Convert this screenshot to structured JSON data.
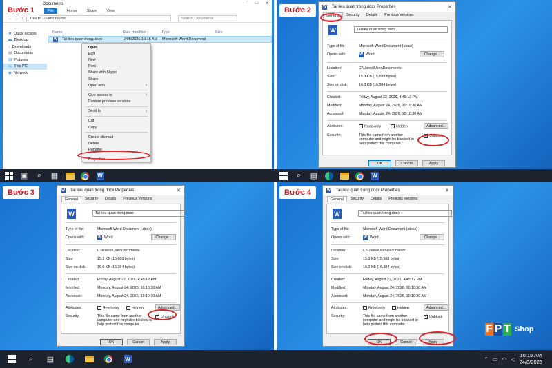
{
  "steps": [
    "Bước 1",
    "Bước 2",
    "Bước 3",
    "Bước 4"
  ],
  "explorer": {
    "title": "Documents",
    "menu": [
      "File",
      "Home",
      "Share",
      "View"
    ],
    "breadcrumb": "This PC  ›  Documents",
    "search_placeholder": "Search Documents",
    "sidebar": [
      "Quick access",
      "Desktop",
      "Downloads",
      "Documents",
      "Pictures",
      "This PC",
      "Network"
    ],
    "columns": [
      "Name",
      "Date modified",
      "Type",
      "Size"
    ],
    "file": {
      "name": "Tai lieu quan trong.docx",
      "date": "24/8/2026 10:15 AM",
      "type": "Microsoft Word Document"
    }
  },
  "context_menu": [
    "Open",
    "Edit",
    "New",
    "Print",
    "Share with Skype",
    "Share",
    "Open with",
    "Give access to",
    "Restore previous versions",
    "Send to",
    "Cut",
    "Copy",
    "Create shortcut",
    "Delete",
    "Rename",
    "Properties"
  ],
  "dialog": {
    "title": "Tai lieu quan trong.docx Properties",
    "tabs": [
      "General",
      "Security",
      "Details",
      "Previous Versions"
    ],
    "filename": "Tai lieu quan trong.docx",
    "type_label": "Type of file:",
    "type_value": "Microsoft Word Document (.docx)",
    "opens_label": "Opens with:",
    "opens_value": "Word",
    "change_btn": "Change...",
    "location_label": "Location:",
    "location_value": "C:\\Users\\User\\Documents",
    "size_label": "Size:",
    "size_value": "15.3 KB (15,688 bytes)",
    "disk_label": "Size on disk:",
    "disk_value": "16.0 KB (16,384 bytes)",
    "created_label": "Created:",
    "created_value": "Friday, August 22, 2026, 4:45:12 PM",
    "modified_label": "Modified:",
    "modified_value": "Monday, August 24, 2026, 10:10:30 AM",
    "accessed_label": "Accessed:",
    "accessed_value": "Monday, August 24, 2026, 10:10:30 AM",
    "attributes_label": "Attributes:",
    "readonly": "Read-only",
    "hidden": "Hidden",
    "advanced_btn": "Advanced...",
    "security_label": "Security:",
    "security_text": "This file came from another computer and might be blocked to help protect this computer.",
    "unblock": "Unblock",
    "ok": "OK",
    "cancel": "Cancel",
    "apply": "Apply"
  },
  "clock": {
    "time": "10:15 AM",
    "date": "24/8/2026"
  },
  "brand": {
    "letters": [
      "F",
      "P",
      "T"
    ],
    "shop": "Shop",
    "colors": [
      "#f36f21",
      "#1a4fa3",
      "#2bb24c"
    ]
  },
  "colors": {
    "desktop": "#1a7fd6",
    "taskbar": "#1d2430",
    "highlight_circle": "#e0202a",
    "step_text": "#d0141b"
  }
}
